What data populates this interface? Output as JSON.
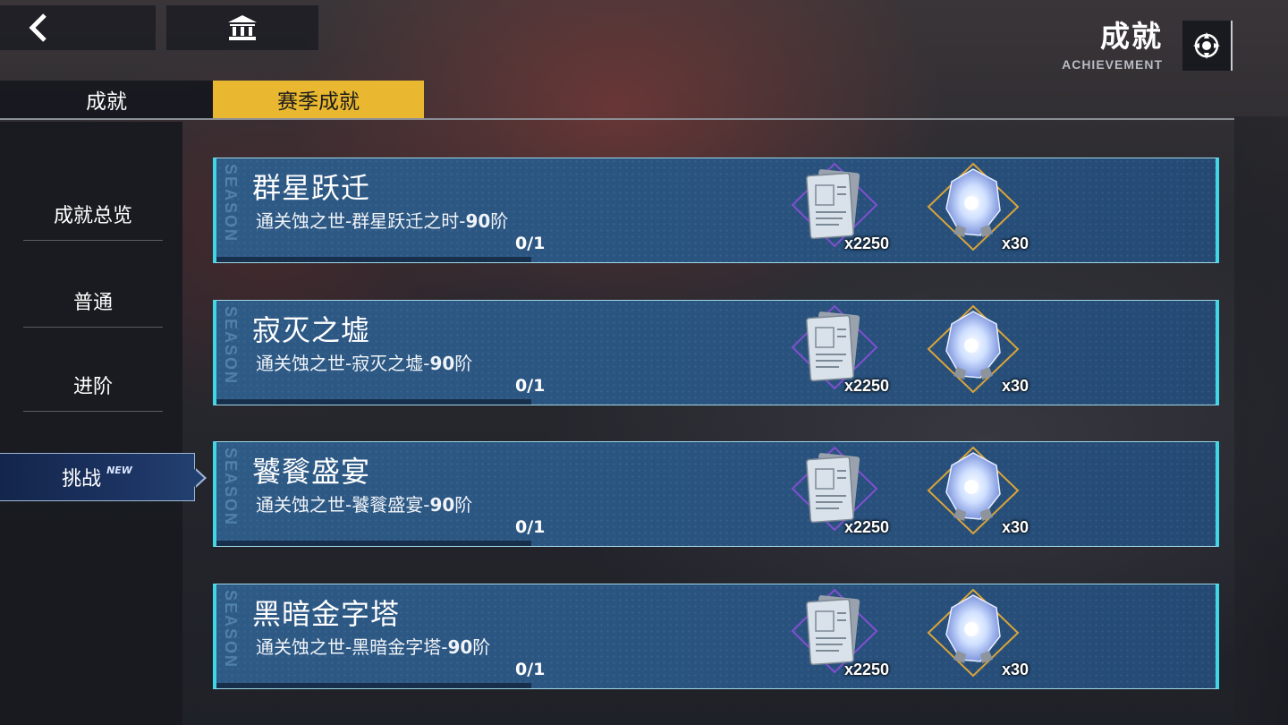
{
  "header": {
    "back_icon": "back-arrow-icon",
    "home_icon": "building-icon",
    "title": "成就",
    "subtitle": "ACHIEVEMENT",
    "settings_icon": "settings-gear-icon"
  },
  "tabs": [
    {
      "label": "成就",
      "active": false
    },
    {
      "label": "赛季成就",
      "active": true
    }
  ],
  "sidebar": {
    "items": [
      {
        "label": "成就总览",
        "active": false
      },
      {
        "label": "普通",
        "active": false
      },
      {
        "label": "进阶",
        "active": false
      },
      {
        "label": "挑战",
        "active": true,
        "tag": "NEW"
      }
    ]
  },
  "colors": {
    "tab_active": "#e9b830",
    "card_border": "#3fd6e6",
    "card_bg": "#2a5480",
    "sidebar_active": "#1d3564"
  },
  "achievements": [
    {
      "title": "群星跃迁",
      "desc_prefix": "通关蚀之世-群星跃迁之时-",
      "desc_bold": "90",
      "desc_suffix": "阶",
      "progress_text": "0/1",
      "progress": 0,
      "rewards": [
        {
          "icon": "document-stack-icon",
          "count": "x2250"
        },
        {
          "icon": "crystal-icon",
          "count": "x30"
        }
      ]
    },
    {
      "title": "寂灭之墟",
      "desc_prefix": "通关蚀之世-寂灭之墟-",
      "desc_bold": "90",
      "desc_suffix": "阶",
      "progress_text": "0/1",
      "progress": 0,
      "rewards": [
        {
          "icon": "document-stack-icon",
          "count": "x2250"
        },
        {
          "icon": "crystal-icon",
          "count": "x30"
        }
      ]
    },
    {
      "title": "饕餮盛宴",
      "desc_prefix": "通关蚀之世-饕餮盛宴-",
      "desc_bold": "90",
      "desc_suffix": "阶",
      "progress_text": "0/1",
      "progress": 0,
      "rewards": [
        {
          "icon": "document-stack-icon",
          "count": "x2250"
        },
        {
          "icon": "crystal-icon",
          "count": "x30"
        }
      ]
    },
    {
      "title": "黑暗金字塔",
      "desc_prefix": "通关蚀之世-黑暗金字塔-",
      "desc_bold": "90",
      "desc_suffix": "阶",
      "progress_text": "0/1",
      "progress": 0,
      "rewards": [
        {
          "icon": "document-stack-icon",
          "count": "x2250"
        },
        {
          "icon": "crystal-icon",
          "count": "x30"
        }
      ]
    }
  ]
}
